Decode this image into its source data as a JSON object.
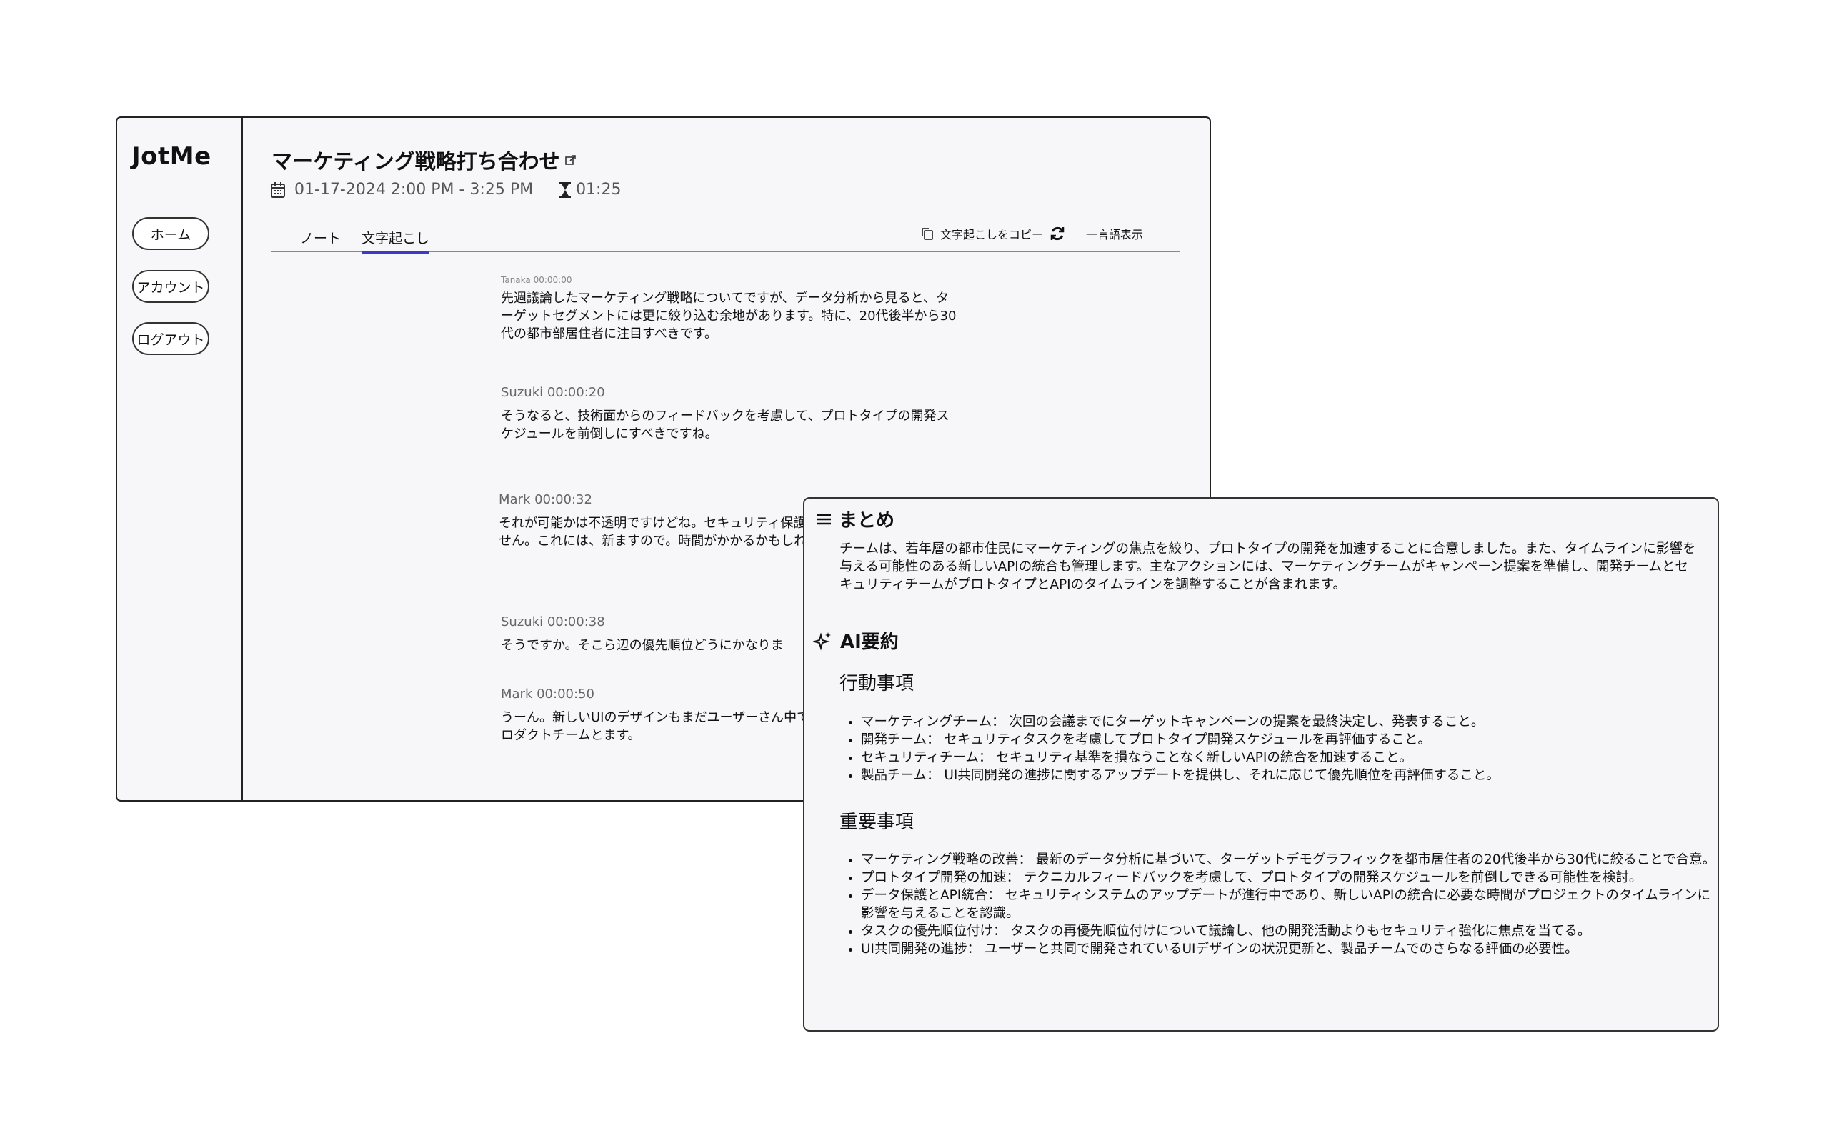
{
  "sidebar": {
    "logo": "JotMe",
    "buttons": [
      "ホーム",
      "アカウント",
      "ログアウト"
    ]
  },
  "meeting": {
    "title": "マーケティング戦略打ち合わせ",
    "datetime": "01-17-2024 2:00 PM - 3:25 PM",
    "duration": "01:25"
  },
  "tabs": [
    {
      "label": "ノート",
      "active": false
    },
    {
      "label": "文字起こし",
      "active": true
    }
  ],
  "actions": {
    "copy_label": "文字起こしをコピー",
    "single_language_label": "一言語表示"
  },
  "transcript": [
    {
      "speaker": "Tanaka 00:00:00",
      "text": "先週議論したマーケティング戦略についてですが、データ分析から見ると、ターゲットセグメントには更に絞り込む余地があります。特に、20代後半から30代の都市部居住者に注目すべきです。"
    },
    {
      "speaker": "Suzuki 00:00:20",
      "text": "そうなると、技術面からのフィードバックを考慮して、プロトタイプの開発スケジュールを前倒しにすべきですね。"
    },
    {
      "speaker": "Mark 00:00:32",
      "text": "それが可能かは不透明ですけどね。セキュリティ保護の強化がまだ終わってません。これには、新ますので。時間がかかるかもしれません。"
    },
    {
      "speaker": "Suzuki 00:00:38",
      "text": "そうですか。そこら辺の優先順位どうにかなりま"
    },
    {
      "speaker": "Mark 00:00:50",
      "text": "うーん。新しいUIのデザインもまだユーザーさん中ですしね。そこら辺またプロダクトチームとます。"
    }
  ],
  "summary": {
    "heading": "まとめ",
    "text": "チームは、若年層の都市住民にマーケティングの焦点を絞り、プロトタイプの開発を加速することに合意しました。また、タイムラインに影響を与える可能性のある新しいAPIの統合も管理します。主なアクションには、マーケティングチームがキャンペーン提案を準備し、開発チームとセキュリティチームがプロトタイプとAPIのタイムラインを調整することが含まれます。"
  },
  "ai_summary": {
    "heading": "AI要約",
    "action_items_heading": "行動事項",
    "action_items": [
      "マーケティングチーム： 次回の会議までにターゲットキャンペーンの提案を最終決定し、発表すること。",
      "開発チーム： セキュリティタスクを考慮してプロトタイプ開発スケジュールを再評価すること。",
      "セキュリティチーム： セキュリティ基準を損なうことなく新しいAPIの統合を加速すること。",
      "製品チーム： UI共同開発の進捗に関するアップデートを提供し、それに応じて優先順位を再評価すること。"
    ],
    "key_points_heading": "重要事項",
    "key_points": [
      "マーケティング戦略の改善： 最新のデータ分析に基づいて、ターゲットデモグラフィックを都市居住者の20代後半から30代に絞ることで合意。",
      "プロトタイプ開発の加速： テクニカルフィードバックを考慮して、プロトタイプの開発スケジュールを前倒しできる可能性を検討。",
      "データ保護とAPI統合： セキュリティシステムのアップデートが進行中であり、新しいAPIの統合に必要な時間がプロジェクトのタイムラインに影響を与えることを認識。",
      "タスクの優先順位付け： タスクの再優先順位付けについて議論し、他の開発活動よりもセキュリティ強化に焦点を当てる。",
      "UI共同開発の進捗： ユーザーと共同で開発されているUIデザインの状況更新と、製品チームでのさらなる評価の必要性。"
    ]
  }
}
